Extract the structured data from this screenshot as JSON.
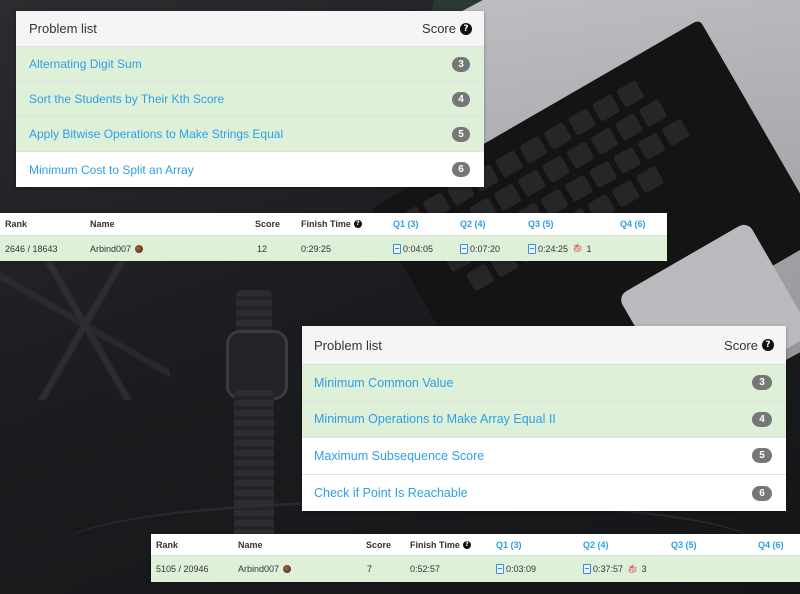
{
  "colors": {
    "link": "#2d9fe6",
    "solved_row": "#dff0d8",
    "badge": "#777777",
    "header_bg": "#f5f5f5"
  },
  "problem_lists": [
    {
      "title": "Problem list",
      "score_label": "Score",
      "help_icon": "question-circle-icon",
      "problems": [
        {
          "name": "Alternating Digit Sum",
          "score": "3",
          "solved": true
        },
        {
          "name": "Sort the Students by Their Kth Score",
          "score": "4",
          "solved": true
        },
        {
          "name": "Apply Bitwise Operations to Make Strings Equal",
          "score": "5",
          "solved": true
        },
        {
          "name": "Minimum Cost to Split an Array",
          "score": "6",
          "solved": false
        }
      ]
    },
    {
      "title": "Problem list",
      "score_label": "Score",
      "help_icon": "question-circle-icon",
      "problems": [
        {
          "name": "Minimum Common Value",
          "score": "3",
          "solved": true
        },
        {
          "name": "Minimum Operations to Make Array Equal II",
          "score": "4",
          "solved": true
        },
        {
          "name": "Maximum Subsequence Score",
          "score": "5",
          "solved": false
        },
        {
          "name": "Check if Point Is Reachable",
          "score": "6",
          "solved": false
        }
      ]
    }
  ],
  "rankings": [
    {
      "headers": {
        "rank": "Rank",
        "name": "Name",
        "score": "Score",
        "finish_time": "Finish Time",
        "q1": "Q1 (3)",
        "q2": "Q2 (4)",
        "q3": "Q3 (5)",
        "q4": "Q4 (6)"
      },
      "row": {
        "rank": "2646 / 18643",
        "name": "Arbind007",
        "score": "12",
        "finish_time": "0:29:25",
        "q1": "0:04:05",
        "q2": "0:07:20",
        "q3": "0:24:25",
        "q3_penalty": "1",
        "q4": ""
      }
    },
    {
      "headers": {
        "rank": "Rank",
        "name": "Name",
        "score": "Score",
        "finish_time": "Finish Time",
        "q1": "Q1 (3)",
        "q2": "Q2 (4)",
        "q3": "Q3 (5)",
        "q4": "Q4 (6)"
      },
      "row": {
        "rank": "5105 / 20946",
        "name": "Arbind007",
        "score": "7",
        "finish_time": "0:52:57",
        "q1": "0:03:09",
        "q2": "0:37:57",
        "q2_penalty": "3",
        "q3": "",
        "q4": ""
      }
    }
  ]
}
